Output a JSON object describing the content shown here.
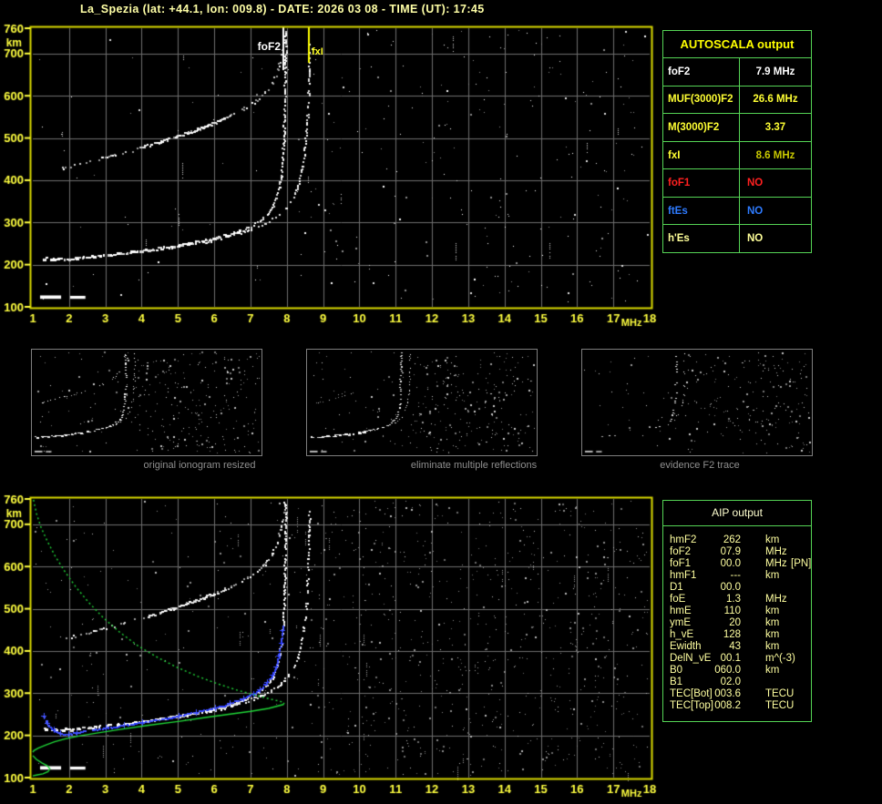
{
  "title": "La_Spezia (lat: +44.1, lon: 009.8) - DATE: 2026 03 08 - TIME (UT): 17:45",
  "station": {
    "name": "La_Spezia",
    "lat": "+44.1",
    "lon": "009.8",
    "date": "2026 03 08",
    "time_ut": "17:45"
  },
  "colors": {
    "title": "#ffffa6",
    "axis_frame": "#d8d800",
    "axis_labels": "#ffff3f",
    "grid": "#6e6e6e",
    "table_border": "#55d455",
    "autoscala_header": "#ffff00",
    "aip_text": "#ffffa0",
    "trace_white": "#ffffff",
    "fitted_trace_blue": "#2a3cff",
    "profile_green": "#1fd637",
    "caption_gray": "#8f8f8f"
  },
  "autoscala_table": {
    "header": "AUTOSCALA output",
    "rows": [
      {
        "label": "foF2",
        "value": "7.9 MHz",
        "label_color": "#ffffff",
        "value_color": "#ffffff",
        "align": "center"
      },
      {
        "label": "MUF(3000)F2",
        "value": "26.6 MHz",
        "label_color": "#ffff33",
        "value_color": "#ffff33",
        "align": "center"
      },
      {
        "label": "M(3000)F2",
        "value": "3.37",
        "label_color": "#ffff33",
        "value_color": "#ffff33",
        "align": "center"
      },
      {
        "label": "fxI",
        "value": "8.6 MHz",
        "label_color": "#ffff33",
        "value_color": "#c8c800",
        "align": "center"
      },
      {
        "label": "foF1",
        "value": "NO",
        "label_color": "#ff2020",
        "value_color": "#ff2020",
        "align": "left"
      },
      {
        "label": "ftEs",
        "value": "NO",
        "label_color": "#2e7bff",
        "value_color": "#2e7bff",
        "align": "left"
      },
      {
        "label": "h'Es",
        "value": "NO",
        "label_color": "#ffff99",
        "value_color": "#ffff99",
        "align": "left"
      }
    ]
  },
  "aip_table": {
    "header": "AIP output",
    "rows": [
      {
        "param": "hmF2",
        "value": "262",
        "unit": "km",
        "extra": ""
      },
      {
        "param": "foF2",
        "value": "07.9",
        "unit": "MHz",
        "extra": ""
      },
      {
        "param": "foF1",
        "value": "00.0",
        "unit": "MHz",
        "extra": "[PN]"
      },
      {
        "param": "hmF1",
        "value": "---",
        "unit": "km",
        "extra": ""
      },
      {
        "param": "D1",
        "value": "00.0",
        "unit": "",
        "extra": ""
      },
      {
        "param": "foE",
        "value": "1.3",
        "unit": "MHz",
        "extra": ""
      },
      {
        "param": "hmE",
        "value": "110",
        "unit": "km",
        "extra": ""
      },
      {
        "param": "ymE",
        "value": "20",
        "unit": "km",
        "extra": ""
      },
      {
        "param": "h_vE",
        "value": "128",
        "unit": "km",
        "extra": ""
      },
      {
        "param": "Ewidth",
        "value": "43",
        "unit": "km",
        "extra": ""
      },
      {
        "param": "DelN_vE",
        "value": "00.1",
        "unit": "m^(-3)",
        "extra": ""
      },
      {
        "param": "B0",
        "value": "060.0",
        "unit": "km",
        "extra": ""
      },
      {
        "param": "B1",
        "value": "02.0",
        "unit": "",
        "extra": ""
      },
      {
        "param": "TEC[Bot]",
        "value": "003.6",
        "unit": "TECU",
        "extra": ""
      },
      {
        "param": "TEC[Top]",
        "value": "008.2",
        "unit": "TECU",
        "extra": ""
      }
    ]
  },
  "thumbnails": [
    {
      "caption": "original ionogram resized"
    },
    {
      "caption": "eliminate multiple reflections"
    },
    {
      "caption": "evidence F2 trace"
    }
  ],
  "chart_data": {
    "type": "scatter",
    "description": "Ionogram echo traces: virtual height (km) vs sounding frequency (MHz); shown twice (raw autoscaled on top, with fitted trace and Ne profile below)",
    "x_axis": {
      "label": "MHz",
      "min": 1,
      "max": 18,
      "ticks": [
        "1",
        "2",
        "3",
        "4",
        "5",
        "6",
        "7",
        "8",
        "9",
        "10",
        "11",
        "12",
        "13",
        "14",
        "15",
        "16",
        "17",
        "18"
      ]
    },
    "y_axis": {
      "label": "km",
      "min": 100,
      "max": 760,
      "ticks": [
        "760",
        "700",
        "600",
        "500",
        "400",
        "300",
        "200",
        "100"
      ]
    },
    "markers": [
      {
        "name": "foF2",
        "mhz": 7.9,
        "color": "#ffffff",
        "line_len": 47
      },
      {
        "name": "fxI",
        "mhz": 8.6,
        "color": "#ffff00",
        "line_len": 39
      }
    ],
    "e_region_blobs": [
      [
        1.2,
        1.78,
        119,
        127
      ],
      [
        2.03,
        2.45,
        119,
        126
      ]
    ],
    "series": [
      {
        "name": "F2-ordinary-trace",
        "plots": [
          "top",
          "bottom",
          "thumb1",
          "thumb2",
          "thumb3"
        ],
        "points": [
          [
            1.28,
            216
          ],
          [
            1.5,
            214
          ],
          [
            1.8,
            214
          ],
          [
            2.1,
            216
          ],
          [
            2.5,
            219
          ],
          [
            3.0,
            223
          ],
          [
            3.5,
            228
          ],
          [
            4.0,
            233
          ],
          [
            4.5,
            239
          ],
          [
            5.0,
            246
          ],
          [
            5.5,
            254
          ],
          [
            6.0,
            263
          ],
          [
            6.4,
            272
          ],
          [
            6.8,
            283
          ],
          [
            7.05,
            292
          ],
          [
            7.25,
            303
          ],
          [
            7.45,
            318
          ],
          [
            7.6,
            336
          ],
          [
            7.7,
            356
          ],
          [
            7.78,
            382
          ],
          [
            7.84,
            414
          ],
          [
            7.88,
            448
          ],
          [
            7.91,
            490
          ],
          [
            7.93,
            540
          ],
          [
            7.95,
            600
          ],
          [
            7.96,
            660
          ],
          [
            7.97,
            750
          ]
        ]
      },
      {
        "name": "F2-extraordinary-trace",
        "plots": [
          "top",
          "bottom",
          "thumb1",
          "thumb2",
          "thumb3"
        ],
        "points": [
          [
            5.6,
            252
          ],
          [
            6.0,
            259
          ],
          [
            6.4,
            268
          ],
          [
            6.8,
            278
          ],
          [
            7.2,
            290
          ],
          [
            7.5,
            303
          ],
          [
            7.8,
            320
          ],
          [
            8.0,
            337
          ],
          [
            8.15,
            356
          ],
          [
            8.28,
            380
          ],
          [
            8.38,
            410
          ],
          [
            8.46,
            445
          ],
          [
            8.52,
            488
          ],
          [
            8.56,
            540
          ],
          [
            8.59,
            600
          ],
          [
            8.61,
            660
          ],
          [
            8.62,
            750
          ]
        ]
      },
      {
        "name": "second-hop-trace",
        "plots": [
          "top",
          "bottom",
          "thumb1"
        ],
        "points": [
          [
            1.75,
            427
          ],
          [
            2.1,
            434
          ],
          [
            2.5,
            443
          ],
          [
            3.0,
            454
          ],
          [
            3.5,
            466
          ],
          [
            4.0,
            478
          ],
          [
            4.5,
            491
          ],
          [
            5.0,
            505
          ],
          [
            5.5,
            520
          ],
          [
            6.0,
            536
          ],
          [
            6.4,
            551
          ],
          [
            6.8,
            568
          ],
          [
            7.1,
            585
          ],
          [
            7.4,
            607
          ],
          [
            7.6,
            630
          ],
          [
            7.75,
            660
          ],
          [
            7.85,
            695
          ],
          [
            7.92,
            730
          ],
          [
            7.95,
            755
          ]
        ]
      },
      {
        "name": "fitted-F2-trace",
        "plots": [
          "bottom"
        ],
        "color": "#2a3cff",
        "points": [
          [
            1.3,
            247
          ],
          [
            1.4,
            228
          ],
          [
            1.55,
            213
          ],
          [
            1.75,
            204
          ],
          [
            1.95,
            202
          ],
          [
            2.2,
            206
          ],
          [
            2.5,
            211
          ],
          [
            3.0,
            217
          ],
          [
            3.5,
            224
          ],
          [
            4.0,
            231
          ],
          [
            4.5,
            238
          ],
          [
            5.0,
            246
          ],
          [
            5.5,
            255
          ],
          [
            6.0,
            265
          ],
          [
            6.4,
            275
          ],
          [
            6.8,
            287
          ],
          [
            7.05,
            297
          ],
          [
            7.25,
            309
          ],
          [
            7.45,
            324
          ],
          [
            7.6,
            342
          ],
          [
            7.7,
            362
          ],
          [
            7.78,
            388
          ],
          [
            7.84,
            418
          ],
          [
            7.88,
            447
          ],
          [
            7.9,
            462
          ]
        ]
      },
      {
        "name": "Ne-profile-topside",
        "plots": [
          "bottom"
        ],
        "color": "#1fd637",
        "style": "dashed-line",
        "points": [
          [
            1.02,
            758
          ],
          [
            1.1,
            726
          ],
          [
            1.22,
            694
          ],
          [
            1.4,
            660
          ],
          [
            1.62,
            624
          ],
          [
            1.9,
            586
          ],
          [
            2.2,
            550
          ],
          [
            2.55,
            514
          ],
          [
            2.95,
            478
          ],
          [
            3.4,
            444
          ],
          [
            3.9,
            412
          ],
          [
            4.45,
            384
          ],
          [
            5.0,
            360
          ],
          [
            5.6,
            338
          ],
          [
            6.1,
            322
          ],
          [
            6.6,
            308
          ],
          [
            7.1,
            296
          ],
          [
            7.5,
            287
          ],
          [
            7.8,
            281
          ],
          [
            7.93,
            277
          ]
        ]
      },
      {
        "name": "Ne-profile-bottomside",
        "plots": [
          "bottom"
        ],
        "color": "#1fd637",
        "style": "line",
        "points": [
          [
            7.93,
            277
          ],
          [
            7.9,
            273
          ],
          [
            7.5,
            264
          ],
          [
            7.0,
            257
          ],
          [
            6.4,
            250
          ],
          [
            5.8,
            243
          ],
          [
            5.0,
            233
          ],
          [
            4.2,
            224
          ],
          [
            3.4,
            214
          ],
          [
            2.8,
            206
          ],
          [
            2.3,
            199
          ],
          [
            1.9,
            192
          ],
          [
            1.6,
            185
          ],
          [
            1.35,
            177
          ],
          [
            1.15,
            170
          ],
          [
            1.03,
            164
          ],
          [
            1.0,
            160
          ]
        ]
      },
      {
        "name": "Ne-profile-E-layer",
        "plots": [
          "bottom"
        ],
        "color": "#1fd637",
        "style": "line",
        "points": [
          [
            1.0,
            152
          ],
          [
            1.1,
            143
          ],
          [
            1.25,
            135
          ],
          [
            1.4,
            128
          ],
          [
            1.47,
            121
          ],
          [
            1.42,
            114
          ],
          [
            1.28,
            109
          ],
          [
            1.1,
            106
          ],
          [
            1.0,
            104
          ]
        ]
      }
    ]
  }
}
